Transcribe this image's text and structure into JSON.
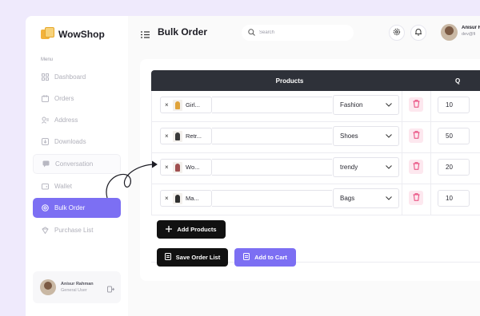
{
  "app": {
    "name": "WowShop"
  },
  "sidebar": {
    "menu_caption": "Menu",
    "items": [
      {
        "label": "Dashboard",
        "icon": "dashboard-icon"
      },
      {
        "label": "Orders",
        "icon": "orders-icon"
      },
      {
        "label": "Address",
        "icon": "address-icon"
      },
      {
        "label": "Downloads",
        "icon": "downloads-icon"
      },
      {
        "label": "Conversation",
        "icon": "conversation-icon"
      },
      {
        "label": "Wallet",
        "icon": "wallet-icon"
      },
      {
        "label": "Bulk Order",
        "icon": "bulk-order-icon",
        "active": true
      },
      {
        "label": "Purchase List",
        "icon": "purchase-list-icon"
      }
    ],
    "profile": {
      "name": "Anisur Rahman",
      "role": "General User"
    }
  },
  "header": {
    "title": "Bulk Order",
    "search_placeholder": "Search",
    "user_name": "Anisur R",
    "user_email": "dev@fi"
  },
  "table": {
    "headers": {
      "products": "Products",
      "quantity": "Q"
    },
    "rows": [
      {
        "product": "Girl...",
        "category": "Fashion",
        "quantity": "10",
        "thumb_color": "#e0a33a"
      },
      {
        "product": "Retr...",
        "category": "Shoes",
        "quantity": "50",
        "thumb_color": "#3a3a3a"
      },
      {
        "product": "Wo...",
        "category": "trendy",
        "quantity": "20",
        "thumb_color": "#a05050"
      },
      {
        "product": "Ma...",
        "category": "Bags",
        "quantity": "10",
        "thumb_color": "#2f2f2f"
      }
    ]
  },
  "actions": {
    "add_products": "Add Products",
    "save_order_list": "Save Order List",
    "add_to_cart": "Add to Cart"
  },
  "colors": {
    "accent": "#7c6ff3",
    "dark": "#111111",
    "danger": "#e8457a",
    "table_header": "#2e3139"
  }
}
